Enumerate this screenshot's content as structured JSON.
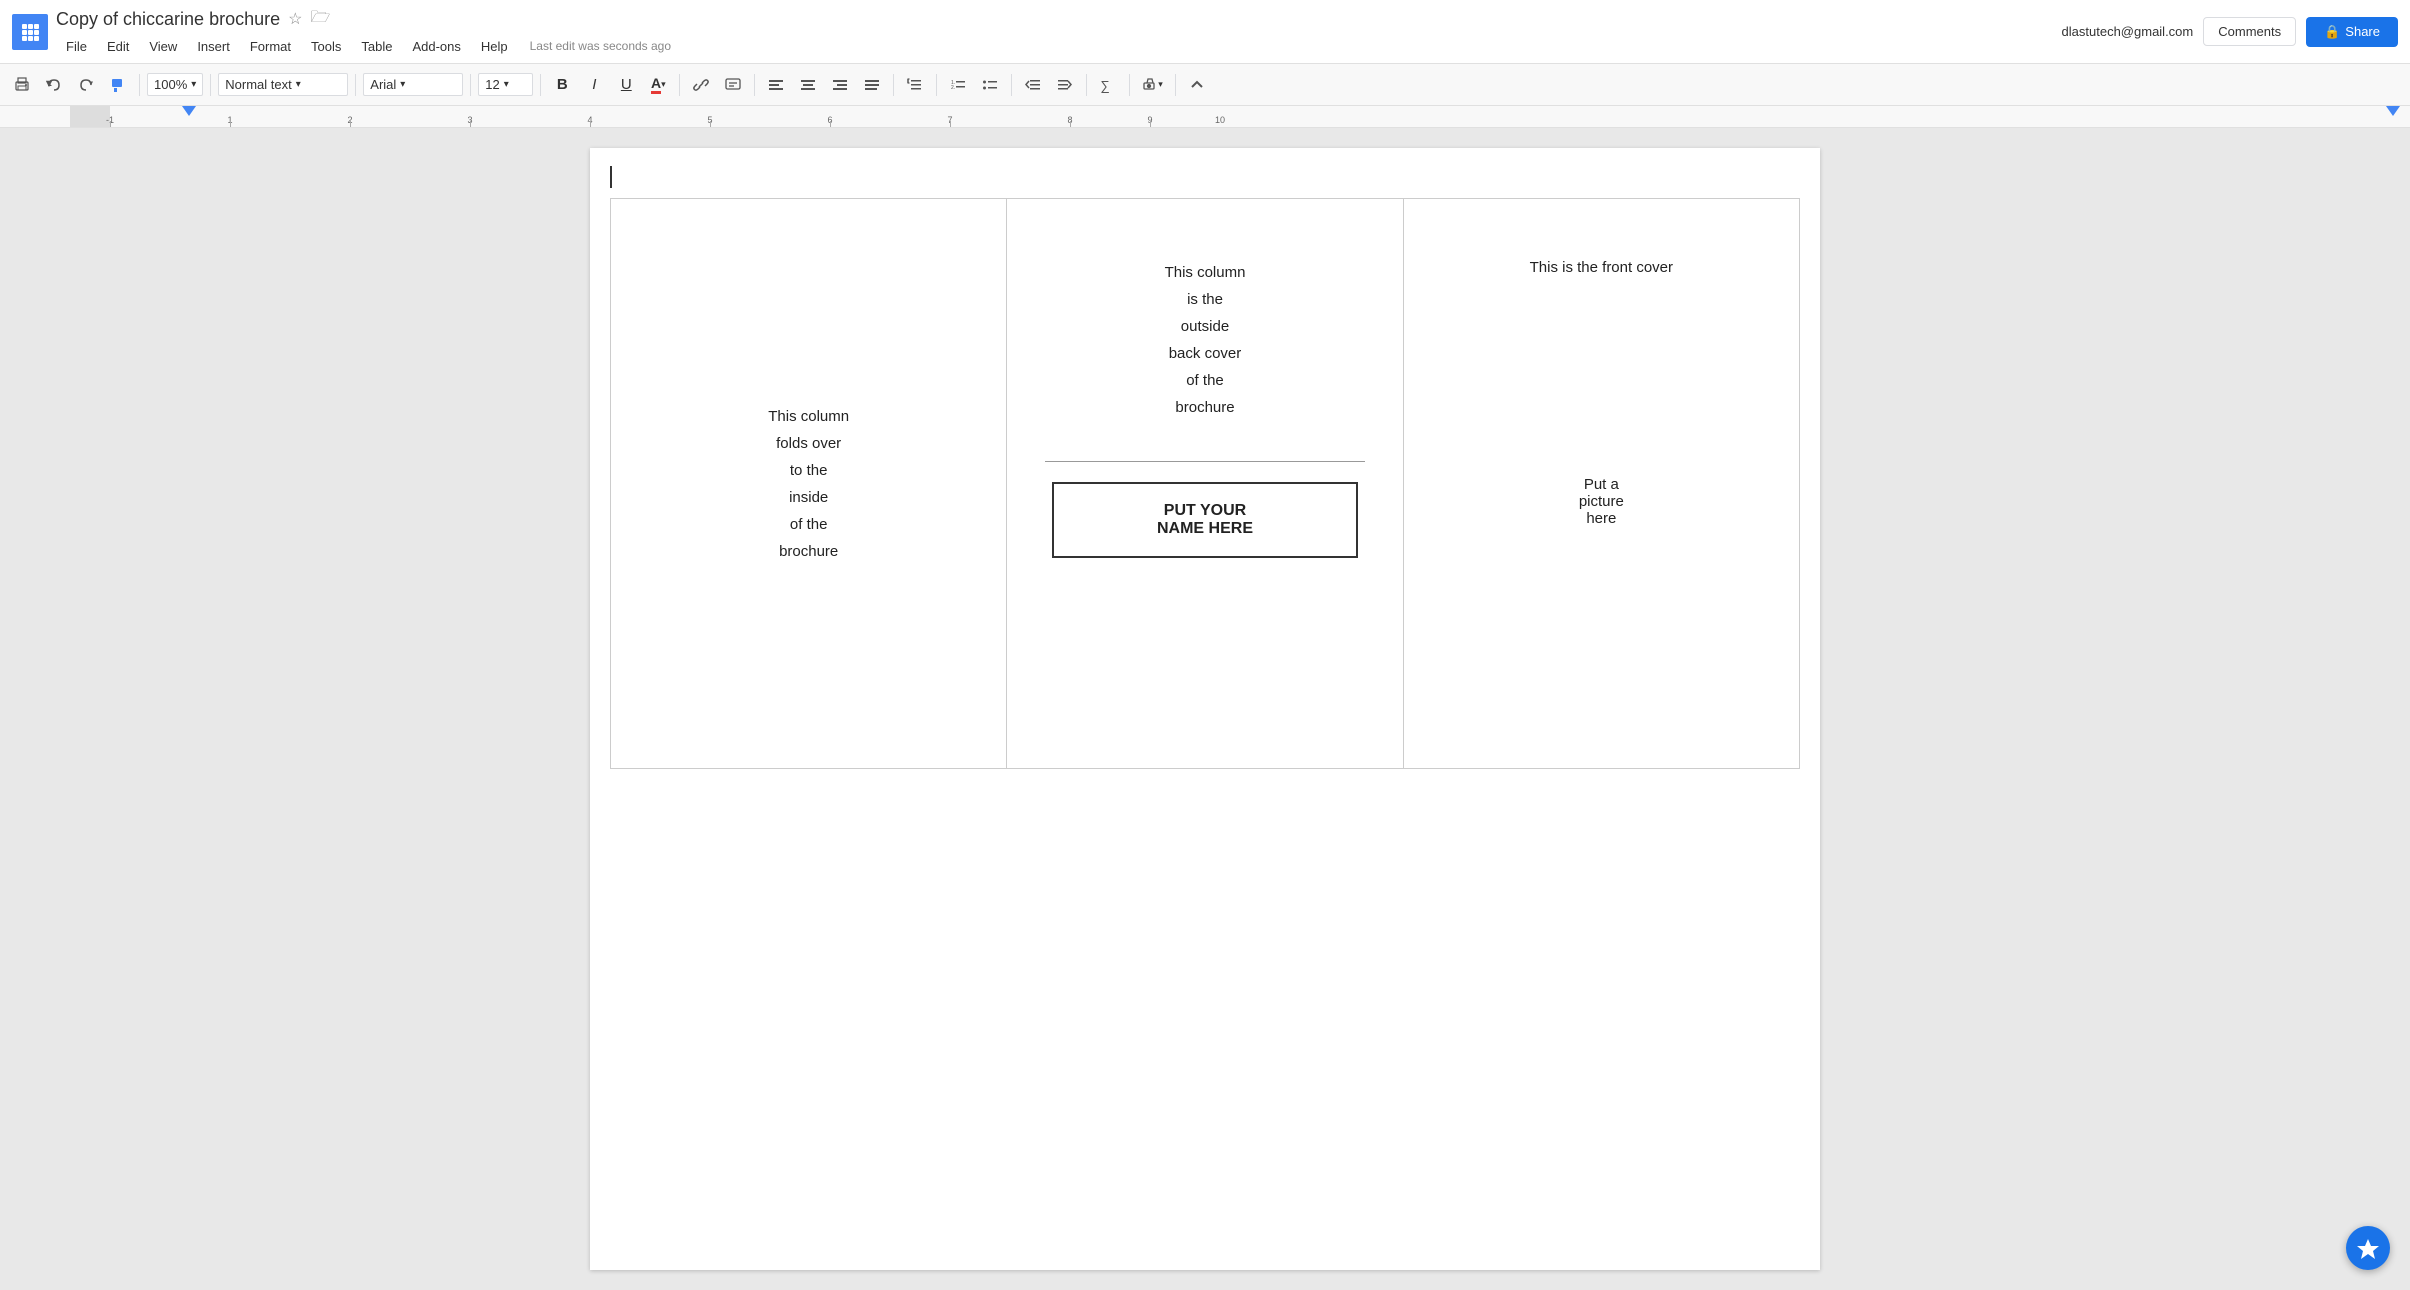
{
  "app": {
    "brand_color": "#4285f4",
    "title": "Copy of chiccarine brochure"
  },
  "topbar": {
    "title": "Copy of chiccarine brochure",
    "star_icon": "☆",
    "folder_icon": "🗁",
    "last_edit": "Last edit was seconds ago",
    "user_email": "dlastutech@gmail.com",
    "comments_label": "Comments",
    "share_label": "Share",
    "share_icon": "🔒"
  },
  "menu": {
    "items": [
      "File",
      "Edit",
      "View",
      "Insert",
      "Format",
      "Tools",
      "Table",
      "Add-ons",
      "Help"
    ]
  },
  "toolbar": {
    "print_icon": "🖨",
    "undo_icon": "↩",
    "redo_icon": "↪",
    "paint_icon": "🖌",
    "zoom_value": "100%",
    "zoom_dropdown": "▾",
    "style_label": "Normal text",
    "style_dropdown": "▾",
    "font_label": "Arial",
    "font_dropdown": "▾",
    "size_label": "12",
    "size_dropdown": "▾",
    "bold_icon": "B",
    "italic_icon": "I",
    "underline_icon": "U",
    "text_color_icon": "A",
    "link_icon": "🔗",
    "comment_icon": "💬",
    "align_left": "≡",
    "align_center": "≡",
    "align_right": "≡",
    "align_justify": "≡",
    "line_spacing_icon": "≡",
    "numbered_list_icon": "≡",
    "bullet_list_icon": "≡",
    "indent_less_icon": "←",
    "indent_more_icon": "→",
    "formula_icon": "∑",
    "pen_icon": "✏",
    "collapse_icon": "⌃"
  },
  "ruler": {
    "marks": [
      "-1",
      "1",
      "2",
      "3",
      "4",
      "5",
      "6",
      "7",
      "8",
      "9",
      "10"
    ]
  },
  "document": {
    "col1": {
      "text": "This column\nfolds over\nto the\ninside\nof the\nbrochure"
    },
    "col2": {
      "main_text": "This column\nis the\noutside\nback cover\nof the\nbrochure",
      "name_box_line1": "PUT YOUR",
      "name_box_line2": "NAME HERE"
    },
    "col3": {
      "title": "This is the front cover",
      "picture_text": "Put a\npicture\nhere"
    }
  }
}
